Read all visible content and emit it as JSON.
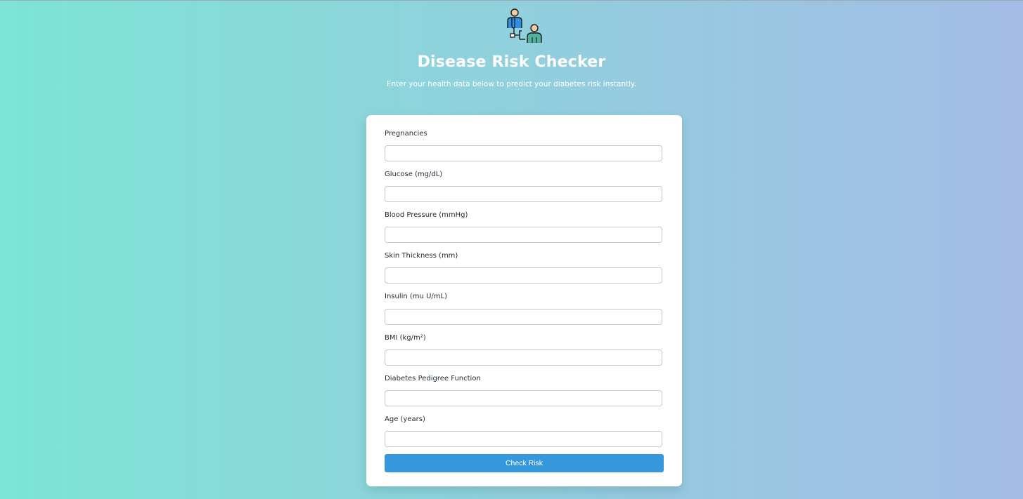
{
  "header": {
    "logo_icon": "doctor-patient-icon",
    "title": "Disease Risk Checker",
    "subtitle": "Enter your health data below to predict your diabetes risk instantly."
  },
  "form": {
    "fields": [
      {
        "label": "Pregnancies",
        "value": "",
        "placeholder": ""
      },
      {
        "label": "Glucose (mg/dL)",
        "value": "",
        "placeholder": ""
      },
      {
        "label": "Blood Pressure (mmHg)",
        "value": "",
        "placeholder": ""
      },
      {
        "label": "Skin Thickness (mm)",
        "value": "",
        "placeholder": ""
      },
      {
        "label": "Insulin (mu U/mL)",
        "value": "",
        "placeholder": ""
      },
      {
        "label": "BMI (kg/m²)",
        "value": "",
        "placeholder": ""
      },
      {
        "label": "Diabetes Pedigree Function",
        "value": "",
        "placeholder": ""
      },
      {
        "label": "Age (years)",
        "value": "",
        "placeholder": ""
      }
    ],
    "submit_label": "Check Risk"
  },
  "colors": {
    "background_start": "#7de4d7",
    "background_end": "#a4bce6",
    "button": "#3598dc",
    "title_text": "#ffffff"
  }
}
